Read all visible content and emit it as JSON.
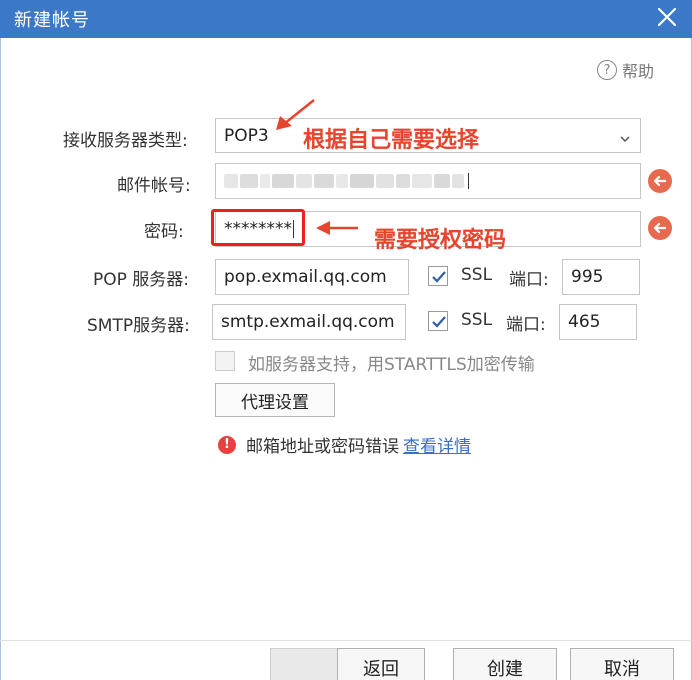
{
  "window": {
    "title": "新建帐号",
    "close_icon": "close-icon"
  },
  "help": {
    "label": "帮助",
    "icon": "?"
  },
  "form": {
    "server_type_label": "接收服务器类型:",
    "server_type_value": "POP3",
    "account_label": "邮件帐号:",
    "password_label": "密码:",
    "password_value": "********",
    "pop_label": "POP 服务器:",
    "pop_value": "pop.exmail.qq.com",
    "pop_ssl_label": "SSL",
    "pop_port_label": "端口:",
    "pop_port_value": "995",
    "smtp_label": "SMTP服务器:",
    "smtp_value": "smtp.exmail.qq.com",
    "smtp_ssl_label": "SSL",
    "smtp_port_label": "端口:",
    "smtp_port_value": "465",
    "starttls_label": "如服务器支持，用STARTTLS加密传输",
    "proxy_button": "代理设置"
  },
  "error": {
    "icon": "!",
    "message": "邮箱地址或密码错误",
    "link": "查看详情"
  },
  "footer": {
    "back": "返回",
    "create": "创建",
    "cancel": "取消"
  },
  "annotations": {
    "select_hint": "根据自己需要选择",
    "password_hint": "需要授权密码"
  },
  "colors": {
    "titlebar": "#3c78c8",
    "annotation": "#e8432c",
    "link": "#3b6fc4",
    "error": "#e84040",
    "clear_button": "#e86a4e"
  }
}
